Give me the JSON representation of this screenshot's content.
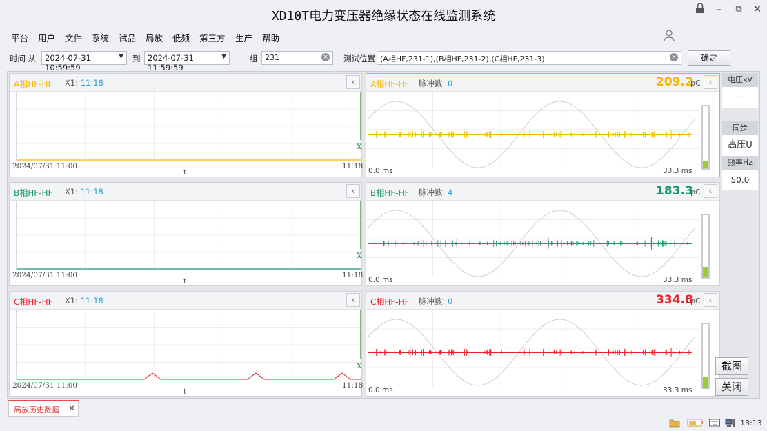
{
  "window": {
    "title": "XD10T电力变压器绝缘状态在线监测系统"
  },
  "menu": [
    "平台",
    "用户",
    "文件",
    "系统",
    "试品",
    "局放",
    "低频",
    "第三方",
    "生产",
    "帮助"
  ],
  "toolbar": {
    "time_label": "时间 从",
    "time_from": "2024-07-31 10:59:59",
    "to_label": "到",
    "time_to": "2024-07-31 11:59:59",
    "group_label": "组",
    "group_value": "231",
    "location_label": "测试位置",
    "location_value": "(A相HF,231-1),(B相HF,231-2),(C相HF,231-3)",
    "confirm": "确定"
  },
  "trend": {
    "x1_label": "X1:",
    "start": "2024/07/31 11:00",
    "end": "11:18",
    "t_label": "t",
    "x_label": "X"
  },
  "channels": [
    {
      "name": "A相HF-HF",
      "x1": "11:18",
      "pulse_label": "脉冲数:",
      "pulse_count": "0",
      "value": "209.2",
      "unit": "pC",
      "color": "#f5b800",
      "t0": "0.0 ms",
      "t1": "33.3 ms"
    },
    {
      "name": "B相HF-HF",
      "x1": "11:18",
      "pulse_label": "脉冲数:",
      "pulse_count": "4",
      "value": "183.3",
      "unit": "pC",
      "color": "#1a9a6a",
      "t0": "0.0 ms",
      "t1": "33.3 ms"
    },
    {
      "name": "C相HF-HF",
      "x1": "11:18",
      "pulse_label": "脉冲数:",
      "pulse_count": "0",
      "value": "334.8",
      "unit": "pC",
      "color": "#e8232a",
      "t0": "0.0 ms",
      "t1": "33.3 ms"
    }
  ],
  "sidebar": {
    "voltage_label": "电压kV",
    "voltage_value": "- -",
    "sync_label": "同步",
    "sync_value": "高压U",
    "freq_label": "频率Hz",
    "freq_value": "50.0",
    "screenshot": "截图",
    "close": "关闭"
  },
  "tab": {
    "label": "局放历史数据",
    "close": "✕"
  },
  "status": {
    "clock": "13:13"
  },
  "colors": {
    "accent_selected": "#f0a830",
    "x1_value": "#2a9fd8",
    "tab_accent": "#e84b4b"
  }
}
